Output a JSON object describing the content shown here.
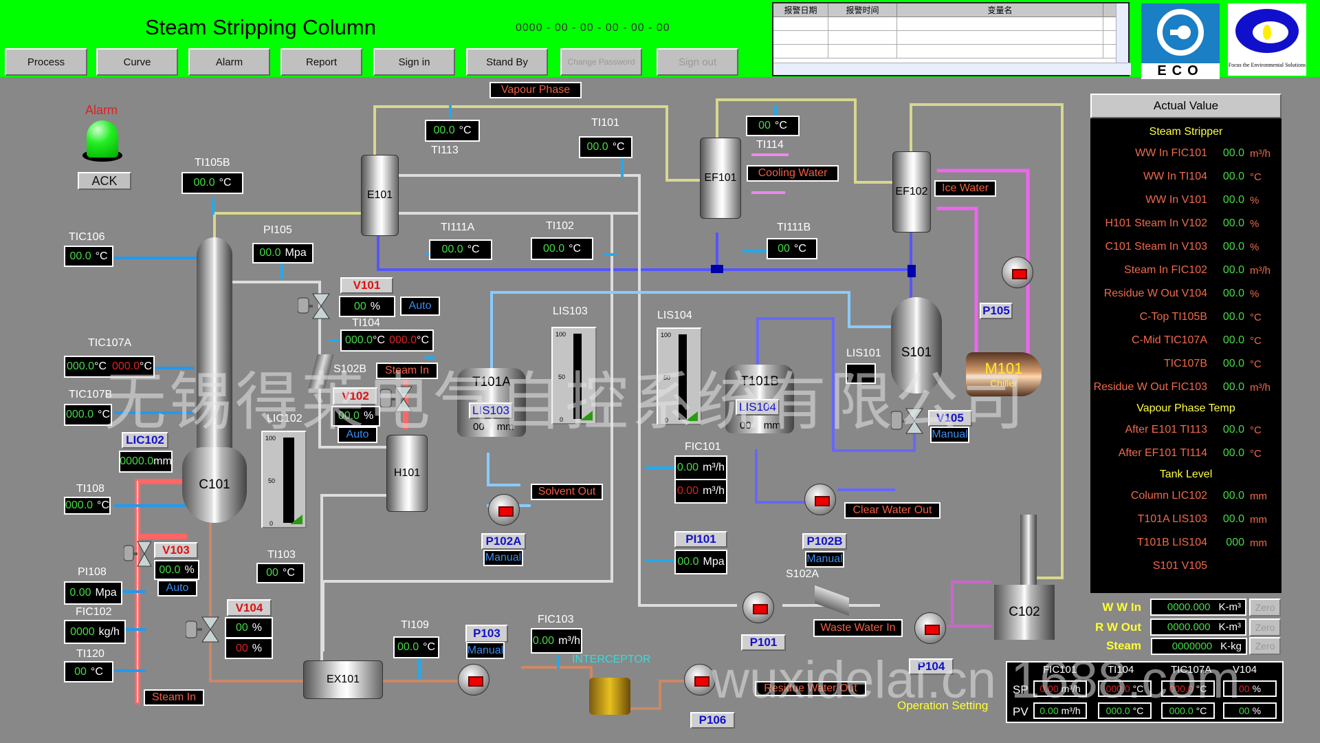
{
  "header": {
    "title": "Steam Stripping Column",
    "clock": "0000 -  00 -  00 -  00 -  00 -  00",
    "nav": [
      {
        "label": "Process",
        "enabled": true
      },
      {
        "label": "Curve",
        "enabled": true
      },
      {
        "label": "Alarm",
        "enabled": true
      },
      {
        "label": "Report",
        "enabled": true
      },
      {
        "label": "Sign in",
        "enabled": true
      },
      {
        "label": "Stand By",
        "enabled": true
      },
      {
        "label": "Change Password",
        "enabled": false
      },
      {
        "label": "Sign out",
        "enabled": false
      }
    ]
  },
  "alarm_table": {
    "columns": [
      "报警日期",
      "报警时间",
      "变量名"
    ]
  },
  "logos": {
    "eco": "ECO",
    "tagline": "Focus the Environmental Solutions"
  },
  "alarm": {
    "label": "Alarm",
    "ack": "ACK",
    "lamp_color": "#22ee22"
  },
  "labels": {
    "vapour_phase": "Vapour Phase",
    "cooling_water": "Cooling Water",
    "ice_water": "Ice Water",
    "steam_in_1": "Steam In",
    "steam_in_2": "Steam In",
    "solvent_out": "Solvent Out",
    "clear_water_out": "Clear Water Out",
    "waste_water_in": "Waste Water In",
    "residue_water_out": "Residue Water Out",
    "interceptor": "INTERCEPTOR",
    "chiller": "Chiller"
  },
  "equipment": {
    "c101": "C101",
    "c102": "C102",
    "e101": "E101",
    "ef101": "EF101",
    "ef102": "EF102",
    "h101": "H101",
    "ex101": "EX101",
    "t101a": "T101A",
    "t101b": "T101B",
    "s101": "S101",
    "m101": "M101",
    "s102a": "S102A",
    "s102b": "S102B"
  },
  "instruments": {
    "ti105b": {
      "tag": "TI105B",
      "value": "00.0",
      "unit": "°C"
    },
    "tic106": {
      "tag": "TIC106",
      "value": "00.0",
      "unit": "°C"
    },
    "pi105": {
      "tag": "PI105",
      "value": "00.0",
      "unit": "Mpa"
    },
    "ti113": {
      "tag": "TI113",
      "value": "00.0",
      "unit": "°C"
    },
    "ti101": {
      "tag": "TI101",
      "value": "00.0",
      "unit": "°C"
    },
    "ti114": {
      "tag": "TI114",
      "value": "00",
      "unit": "°C"
    },
    "ti111a": {
      "tag": "TI111A",
      "value": "00.0",
      "unit": "°C"
    },
    "ti102": {
      "tag": "TI102",
      "value": "00.0",
      "unit": "°C"
    },
    "ti111b": {
      "tag": "TI111B",
      "value": "00",
      "unit": "°C"
    },
    "ti104": {
      "tag": "TI104",
      "pv": "000.0",
      "sp": "000.0",
      "unit": "°C"
    },
    "tic107a": {
      "tag": "TIC107A",
      "pv": "000.0",
      "sp": "000.0",
      "unit": "°C"
    },
    "tic107b": {
      "tag": "TIC107B",
      "value": "000.0",
      "unit": "°C"
    },
    "lic102": {
      "tag": "LIC102",
      "value": "0000.0",
      "unit": "mm"
    },
    "ti108": {
      "tag": "TI108",
      "value": "000.0",
      "unit": "°C"
    },
    "pi108": {
      "tag": "PI108",
      "value": "0.00",
      "unit": "Mpa"
    },
    "fic102": {
      "tag": "FIC102",
      "value": "0000",
      "unit": "kg/h"
    },
    "ti120": {
      "tag": "TI120",
      "value": "00",
      "unit": "°C"
    },
    "ti103": {
      "tag": "TI103",
      "value": "00",
      "unit": "°C"
    },
    "ti109": {
      "tag": "TI109",
      "value": "00.0",
      "unit": "°C"
    },
    "fic103": {
      "tag": "FIC103",
      "value": "0.00",
      "unit": "m³/h"
    },
    "fic101": {
      "tag": "FIC101",
      "pv": "0.00",
      "sp": "0.00",
      "unit": "m³/h"
    },
    "pi101": {
      "tag": "PI101",
      "value": "00.0",
      "unit": "Mpa"
    },
    "lis103_tank": {
      "tag": "LIS103",
      "value": "00",
      "unit": "mm"
    },
    "lis104_tank": {
      "tag": "LIS104",
      "value": "00",
      "unit": "mm"
    },
    "lis101": {
      "tag": "LIS101"
    }
  },
  "valves": {
    "v101": {
      "tag": "V101",
      "value": "00",
      "unit": "%",
      "mode": "Auto"
    },
    "v102": {
      "tag": "V102",
      "value": "00.0",
      "unit": "%",
      "mode": "Auto"
    },
    "v103": {
      "tag": "V103",
      "value": "00.0",
      "unit": "%",
      "mode": "Auto"
    },
    "v104": {
      "tag": "V104",
      "pv": "00",
      "sp": "00",
      "unit": "%"
    },
    "v105": {
      "tag": "V105",
      "mode": "Manual"
    }
  },
  "pumps": {
    "p101": {
      "tag": "P101"
    },
    "p102a": {
      "tag": "P102A",
      "mode": "Manual"
    },
    "p102b": {
      "tag": "P102B",
      "mode": "Manual"
    },
    "p103": {
      "tag": "P103",
      "mode": "Manual"
    },
    "p104": {
      "tag": "P104"
    },
    "p105": {
      "tag": "P105"
    },
    "p106": {
      "tag": "P106"
    }
  },
  "level_gauges": [
    {
      "tag": "LIC102",
      "scale": [
        "100",
        "50",
        "0"
      ],
      "level_percent": 0
    },
    {
      "tag": "LIS103",
      "scale": [
        "100",
        "50",
        "0"
      ],
      "level_percent": 0
    },
    {
      "tag": "LIS104",
      "scale": [
        "100",
        "50",
        "0"
      ],
      "level_percent": 0
    }
  ],
  "actual_value": {
    "header": "Actual Value",
    "sections": [
      {
        "title": "Steam Stripper",
        "rows": [
          {
            "name": "WW In FIC101",
            "value": "00.0",
            "unit": "m³/h"
          },
          {
            "name": "WW In TI104",
            "value": "00.0",
            "unit": "°C"
          },
          {
            "name": "WW In V101",
            "value": "00.0",
            "unit": "%"
          },
          {
            "name": "H101 Steam In V102",
            "value": "00.0",
            "unit": "%"
          },
          {
            "name": "C101 Steam In V103",
            "value": "00.0",
            "unit": "%"
          },
          {
            "name": "Steam In FIC102",
            "value": "00.0",
            "unit": "m³/h"
          },
          {
            "name": "Residue W Out V104",
            "value": "00.0",
            "unit": "%"
          },
          {
            "name": "C-Top TI105B",
            "value": "00.0",
            "unit": "°C"
          },
          {
            "name": "C-Mid TIC107A",
            "value": "00.0",
            "unit": "°C"
          },
          {
            "name": "TIC107B",
            "value": "00.0",
            "unit": "°C"
          },
          {
            "name": "Residue W Out FIC103",
            "value": "00.0",
            "unit": "m³/h"
          }
        ]
      },
      {
        "title": "Vapour Phase Temp",
        "rows": [
          {
            "name": "After E101 TI113",
            "value": "00.0",
            "unit": "°C"
          },
          {
            "name": "After EF101 TI114",
            "value": "00.0",
            "unit": "°C"
          }
        ]
      },
      {
        "title": "Tank Level",
        "rows": [
          {
            "name": "Column LIC102",
            "value": "00.0",
            "unit": "mm"
          },
          {
            "name": "T101A LIS103",
            "value": "00.0",
            "unit": "mm"
          },
          {
            "name": "T101B LIS104",
            "value": "000",
            "unit": "mm"
          },
          {
            "name": "S101  V105",
            "value": "",
            "unit": ""
          }
        ]
      }
    ]
  },
  "totalizers": [
    {
      "label": "W W In",
      "value": "0000.000",
      "unit": "K-m³",
      "reset": "Zero"
    },
    {
      "label": "R W Out",
      "value": "0000.000",
      "unit": "K-m³",
      "reset": "Zero"
    },
    {
      "label": "Steam",
      "value": "0000000",
      "unit": "K-kg",
      "reset": "Zero"
    }
  ],
  "operation_setting": {
    "title": "Operation Setting",
    "sp_label": "SP",
    "pv_label": "PV",
    "columns": [
      {
        "tag": "FIC101",
        "sp": "0.00",
        "pv": "0.00",
        "unit": "m³/h"
      },
      {
        "tag": "TI104",
        "sp": "000.0",
        "pv": "000.0",
        "unit": "°C"
      },
      {
        "tag": "TIC107A",
        "sp": "000.0",
        "pv": "000.0",
        "unit": "°C"
      },
      {
        "tag": "V104",
        "sp": "00",
        "pv": "00",
        "unit": "%"
      }
    ]
  },
  "watermarks": {
    "company": "无锡得莱电气自控系统有限公司",
    "site": "wuxidelai.cn 1688.com"
  }
}
